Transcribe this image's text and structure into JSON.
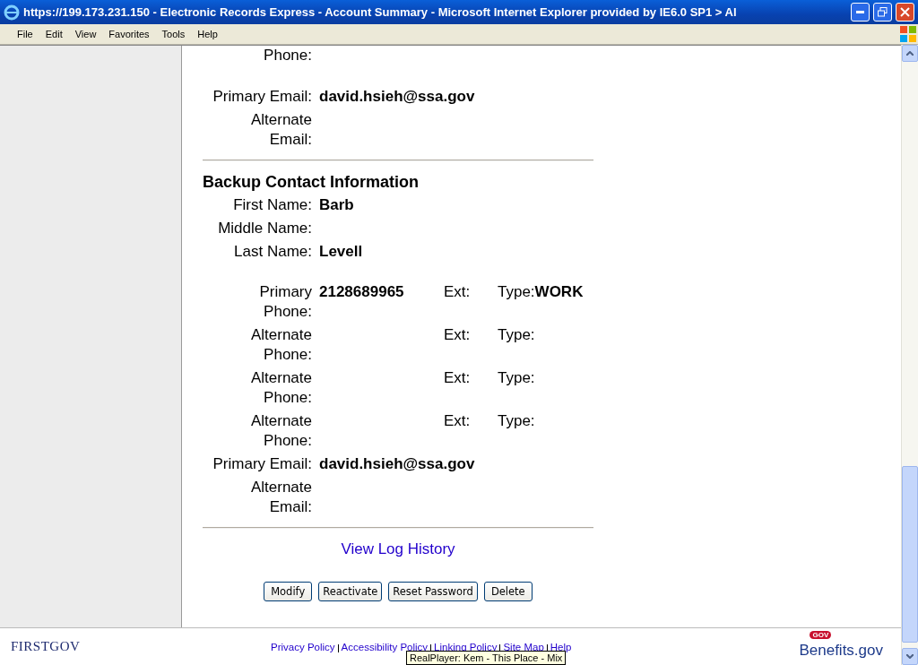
{
  "window": {
    "title": "https://199.173.231.150 - Electronic Records Express - Account Summary - Microsoft Internet Explorer provided by IE6.0 SP1 > Al"
  },
  "menu": [
    "File",
    "Edit",
    "View",
    "Favorites",
    "Tools",
    "Help"
  ],
  "primary_contact": {
    "phone_label_tail": "Phone:",
    "emails": [
      {
        "label": "Primary Email:",
        "value": "david.hsieh@ssa.gov"
      },
      {
        "label": "Alternate Email:"
      }
    ]
  },
  "backup_contact": {
    "heading": "Backup Contact Information",
    "names": [
      {
        "label": "First Name:",
        "value": "Barb"
      },
      {
        "label": "Middle Name:"
      },
      {
        "label": "Last Name:",
        "value": "Levell"
      }
    ],
    "phones": [
      {
        "label": "Primary Phone:",
        "number": "2128689965",
        "ext_label": "Ext:",
        "type_label": "Type:",
        "type": "WORK"
      },
      {
        "label": "Alternate Phone:",
        "ext_label": "Ext:",
        "type_label": "Type:"
      },
      {
        "label": "Alternate Phone:",
        "ext_label": "Ext:",
        "type_label": "Type:"
      },
      {
        "label": "Alternate Phone:",
        "ext_label": "Ext:",
        "type_label": "Type:"
      }
    ],
    "emails": [
      {
        "label": "Primary Email:",
        "value": "david.hsieh@ssa.gov"
      },
      {
        "label": "Alternate Email:"
      }
    ]
  },
  "log_link": "View Log History",
  "buttons": [
    "Modify",
    "Reactivate",
    "Reset Password",
    "Delete"
  ],
  "footer": {
    "logo_left": "FIRSTGOV",
    "links": [
      "Privacy Policy",
      "Accessibility Policy",
      "Linking Policy",
      "Site Map",
      "Help"
    ],
    "logo_badge": "GOV",
    "logo_right": "Benefits.gov"
  },
  "tooltip": "RealPlayer: Kem - This Place - Mix"
}
